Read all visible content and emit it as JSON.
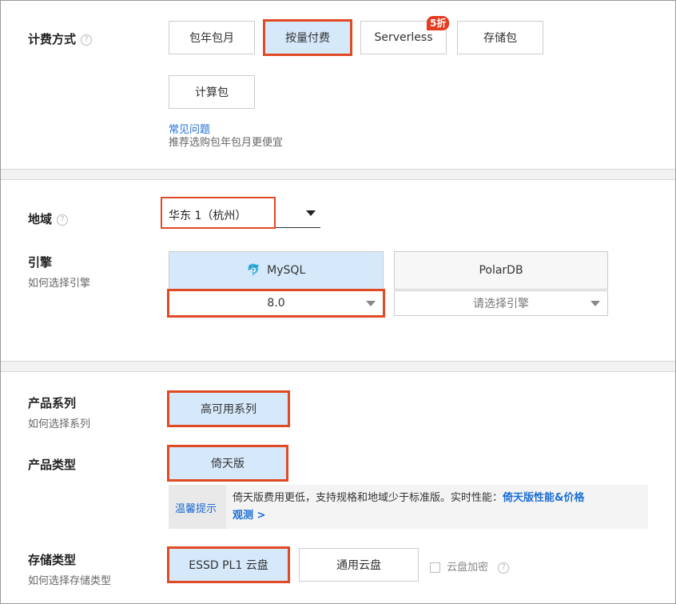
{
  "billing": {
    "label": "计费方式",
    "options": [
      "包年包月",
      "按量付费",
      "Serverless",
      "存储包",
      "计算包"
    ],
    "badge": "5折",
    "faq_link": "常见问题",
    "hint": "推荐选购包年包月更便宜"
  },
  "region": {
    "label": "地域",
    "value": "华东 1（杭州）"
  },
  "engine": {
    "label": "引擎",
    "help_link": "如何选择引擎",
    "options": [
      "MySQL",
      "PolarDB"
    ],
    "mysql_version": "8.0",
    "polardb_placeholder": "请选择引擎"
  },
  "series": {
    "label": "产品系列",
    "help_link": "如何选择系列",
    "value": "高可用系列"
  },
  "product_type": {
    "label": "产品类型",
    "value": "倚天版"
  },
  "tip": {
    "title": "温馨提示",
    "text": "倚天版费用更低，支持规格和地域少于标准版。实时性能：",
    "link1": "倚天版性能&价格",
    "link2": "观测 >"
  },
  "storage": {
    "label": "存储类型",
    "help_link": "如何选择存储类型",
    "options": [
      "ESSD PL1 云盘",
      "通用云盘"
    ],
    "encrypt_label": "云盘加密"
  },
  "colors": {
    "highlight": "#e04a24",
    "selected_bg": "#d6e9fb",
    "link": "#1c6ed5"
  }
}
